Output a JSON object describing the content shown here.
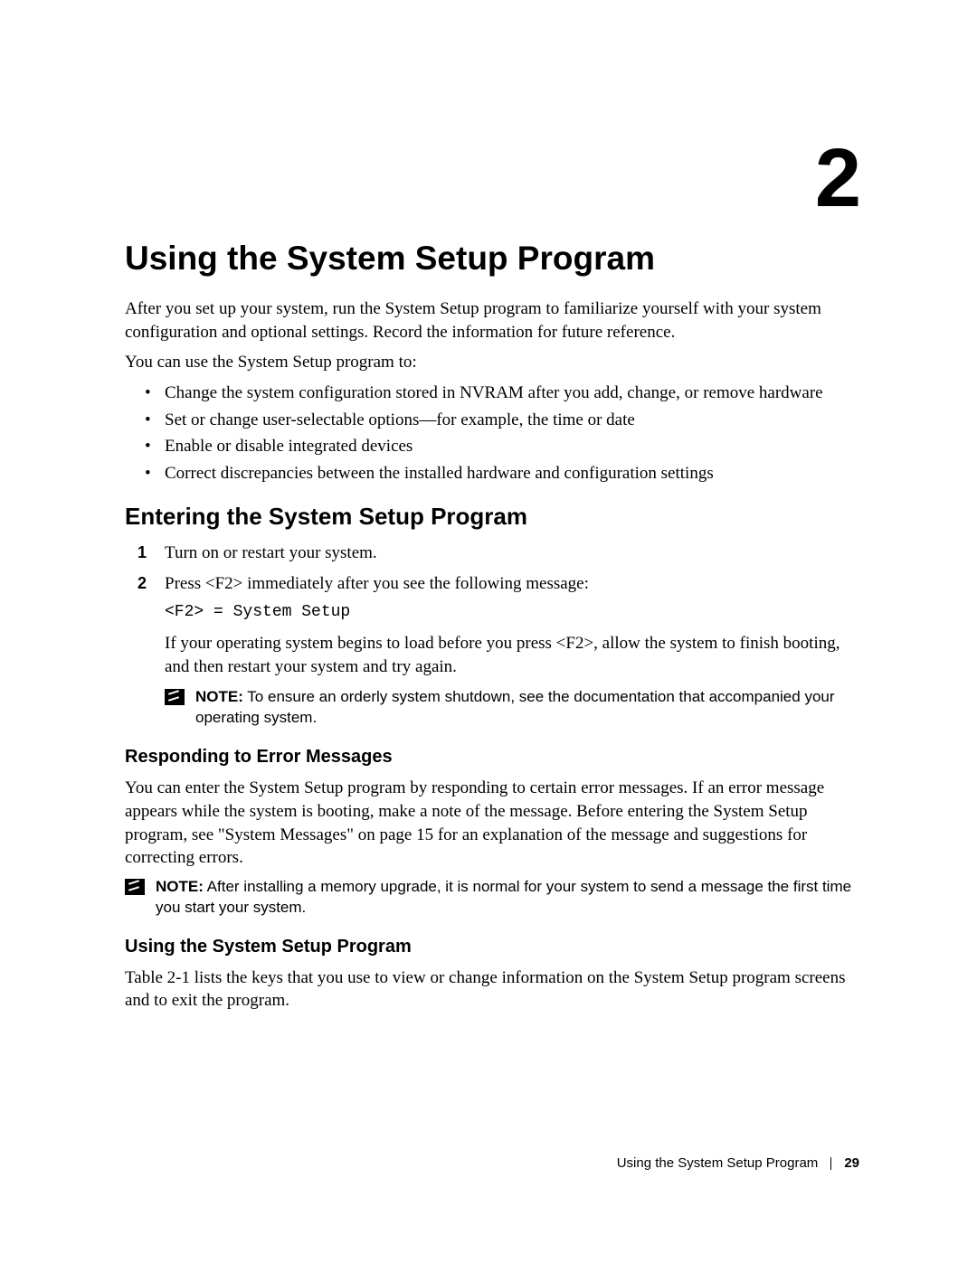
{
  "chapter_number": "2",
  "title": "Using the System Setup Program",
  "intro_p1": "After you set up your system, run the System Setup program to familiarize yourself with your system configuration and optional settings. Record the information for future reference.",
  "intro_p2": "You can use the System Setup program to:",
  "bullets": [
    "Change the system configuration stored in NVRAM after you add, change, or remove hardware",
    "Set or change user-selectable options—for example, the time or date",
    "Enable or disable integrated devices",
    "Correct discrepancies between the installed hardware and configuration settings"
  ],
  "section1": {
    "heading": "Entering the System Setup Program",
    "step1": "Turn on or restart your system.",
    "step2": "Press <F2> immediately after you see the following message:",
    "code": "<F2> = System Setup",
    "step2_sub": "If your operating system begins to load before you press <F2>, allow the system to finish booting, and then restart your system and try again.",
    "note_label": "NOTE:",
    "note_text": " To ensure an orderly system shutdown, see the documentation that accompanied your operating system."
  },
  "sub1": {
    "heading": "Responding to Error Messages",
    "body": "You can enter the System Setup program by responding to certain error messages. If an error message appears while the system is booting, make a note of the message. Before entering the System Setup program, see \"System Messages\" on page 15 for an explanation of the message and suggestions for correcting errors.",
    "note_label": "NOTE:",
    "note_text": " After installing a memory upgrade, it is normal for your system to send a message the first time you start your system."
  },
  "sub2": {
    "heading": "Using the System Setup Program",
    "body": "Table 2-1 lists the keys that you use to view or change information on the System Setup program screens and to exit the program."
  },
  "footer": {
    "title": "Using the System Setup Program",
    "page": "29"
  }
}
